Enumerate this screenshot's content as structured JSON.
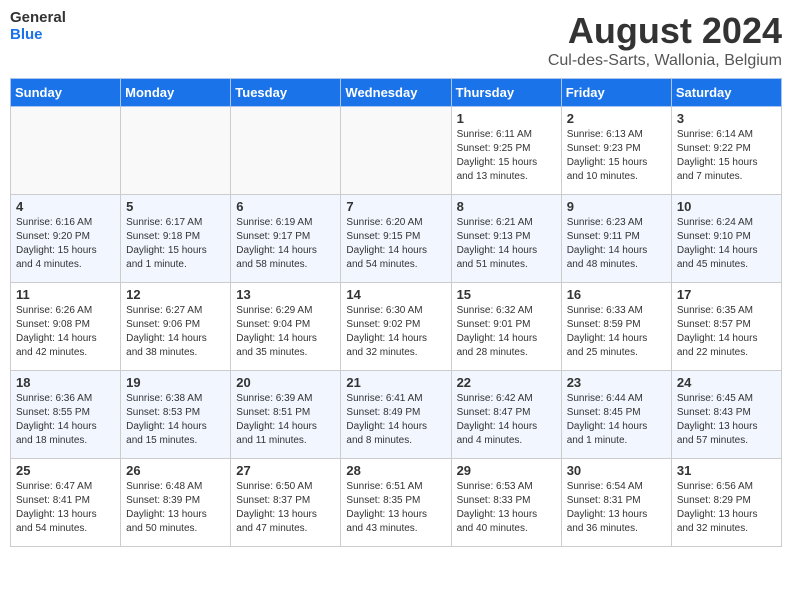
{
  "header": {
    "logo_line1": "General",
    "logo_line2": "Blue",
    "month_title": "August 2024",
    "location": "Cul-des-Sarts, Wallonia, Belgium"
  },
  "days_of_week": [
    "Sunday",
    "Monday",
    "Tuesday",
    "Wednesday",
    "Thursday",
    "Friday",
    "Saturday"
  ],
  "weeks": [
    [
      {
        "day": "",
        "info": ""
      },
      {
        "day": "",
        "info": ""
      },
      {
        "day": "",
        "info": ""
      },
      {
        "day": "",
        "info": ""
      },
      {
        "day": "1",
        "info": "Sunrise: 6:11 AM\nSunset: 9:25 PM\nDaylight: 15 hours\nand 13 minutes."
      },
      {
        "day": "2",
        "info": "Sunrise: 6:13 AM\nSunset: 9:23 PM\nDaylight: 15 hours\nand 10 minutes."
      },
      {
        "day": "3",
        "info": "Sunrise: 6:14 AM\nSunset: 9:22 PM\nDaylight: 15 hours\nand 7 minutes."
      }
    ],
    [
      {
        "day": "4",
        "info": "Sunrise: 6:16 AM\nSunset: 9:20 PM\nDaylight: 15 hours\nand 4 minutes."
      },
      {
        "day": "5",
        "info": "Sunrise: 6:17 AM\nSunset: 9:18 PM\nDaylight: 15 hours\nand 1 minute."
      },
      {
        "day": "6",
        "info": "Sunrise: 6:19 AM\nSunset: 9:17 PM\nDaylight: 14 hours\nand 58 minutes."
      },
      {
        "day": "7",
        "info": "Sunrise: 6:20 AM\nSunset: 9:15 PM\nDaylight: 14 hours\nand 54 minutes."
      },
      {
        "day": "8",
        "info": "Sunrise: 6:21 AM\nSunset: 9:13 PM\nDaylight: 14 hours\nand 51 minutes."
      },
      {
        "day": "9",
        "info": "Sunrise: 6:23 AM\nSunset: 9:11 PM\nDaylight: 14 hours\nand 48 minutes."
      },
      {
        "day": "10",
        "info": "Sunrise: 6:24 AM\nSunset: 9:10 PM\nDaylight: 14 hours\nand 45 minutes."
      }
    ],
    [
      {
        "day": "11",
        "info": "Sunrise: 6:26 AM\nSunset: 9:08 PM\nDaylight: 14 hours\nand 42 minutes."
      },
      {
        "day": "12",
        "info": "Sunrise: 6:27 AM\nSunset: 9:06 PM\nDaylight: 14 hours\nand 38 minutes."
      },
      {
        "day": "13",
        "info": "Sunrise: 6:29 AM\nSunset: 9:04 PM\nDaylight: 14 hours\nand 35 minutes."
      },
      {
        "day": "14",
        "info": "Sunrise: 6:30 AM\nSunset: 9:02 PM\nDaylight: 14 hours\nand 32 minutes."
      },
      {
        "day": "15",
        "info": "Sunrise: 6:32 AM\nSunset: 9:01 PM\nDaylight: 14 hours\nand 28 minutes."
      },
      {
        "day": "16",
        "info": "Sunrise: 6:33 AM\nSunset: 8:59 PM\nDaylight: 14 hours\nand 25 minutes."
      },
      {
        "day": "17",
        "info": "Sunrise: 6:35 AM\nSunset: 8:57 PM\nDaylight: 14 hours\nand 22 minutes."
      }
    ],
    [
      {
        "day": "18",
        "info": "Sunrise: 6:36 AM\nSunset: 8:55 PM\nDaylight: 14 hours\nand 18 minutes."
      },
      {
        "day": "19",
        "info": "Sunrise: 6:38 AM\nSunset: 8:53 PM\nDaylight: 14 hours\nand 15 minutes."
      },
      {
        "day": "20",
        "info": "Sunrise: 6:39 AM\nSunset: 8:51 PM\nDaylight: 14 hours\nand 11 minutes."
      },
      {
        "day": "21",
        "info": "Sunrise: 6:41 AM\nSunset: 8:49 PM\nDaylight: 14 hours\nand 8 minutes."
      },
      {
        "day": "22",
        "info": "Sunrise: 6:42 AM\nSunset: 8:47 PM\nDaylight: 14 hours\nand 4 minutes."
      },
      {
        "day": "23",
        "info": "Sunrise: 6:44 AM\nSunset: 8:45 PM\nDaylight: 14 hours\nand 1 minute."
      },
      {
        "day": "24",
        "info": "Sunrise: 6:45 AM\nSunset: 8:43 PM\nDaylight: 13 hours\nand 57 minutes."
      }
    ],
    [
      {
        "day": "25",
        "info": "Sunrise: 6:47 AM\nSunset: 8:41 PM\nDaylight: 13 hours\nand 54 minutes."
      },
      {
        "day": "26",
        "info": "Sunrise: 6:48 AM\nSunset: 8:39 PM\nDaylight: 13 hours\nand 50 minutes."
      },
      {
        "day": "27",
        "info": "Sunrise: 6:50 AM\nSunset: 8:37 PM\nDaylight: 13 hours\nand 47 minutes."
      },
      {
        "day": "28",
        "info": "Sunrise: 6:51 AM\nSunset: 8:35 PM\nDaylight: 13 hours\nand 43 minutes."
      },
      {
        "day": "29",
        "info": "Sunrise: 6:53 AM\nSunset: 8:33 PM\nDaylight: 13 hours\nand 40 minutes."
      },
      {
        "day": "30",
        "info": "Sunrise: 6:54 AM\nSunset: 8:31 PM\nDaylight: 13 hours\nand 36 minutes."
      },
      {
        "day": "31",
        "info": "Sunrise: 6:56 AM\nSunset: 8:29 PM\nDaylight: 13 hours\nand 32 minutes."
      }
    ]
  ]
}
